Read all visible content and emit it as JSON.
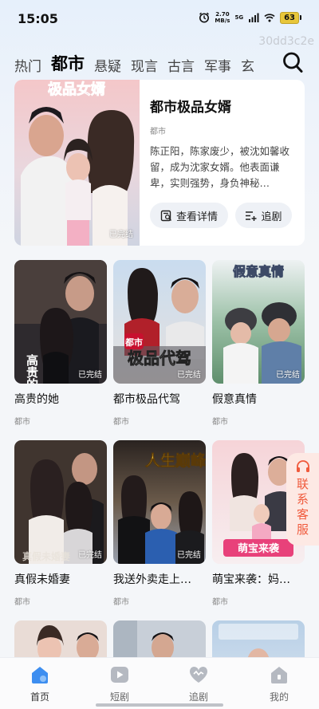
{
  "status_bar": {
    "time": "15:05",
    "net_speed": "2.70",
    "net_unit": "MB/s",
    "signal": "5G",
    "battery": "63"
  },
  "watermark": "30dd3c2e",
  "tabs": [
    {
      "label": "热门",
      "active": false
    },
    {
      "label": "都市",
      "active": true
    },
    {
      "label": "悬疑",
      "active": false
    },
    {
      "label": "现言",
      "active": false
    },
    {
      "label": "古言",
      "active": false
    },
    {
      "label": "军事",
      "active": false
    },
    {
      "label": "玄",
      "active": false
    }
  ],
  "featured": {
    "poster_text": "极品女婿",
    "title": "都市极品女婿",
    "genre": "都市",
    "description": "陈正阳，陈家废少，被沈如馨收留，成为沈家女婿。他表面谦卑，实则强势，身负神秘…",
    "status": "已完结",
    "detail_label": "查看详情",
    "follow_label": "追剧"
  },
  "dramas": [
    {
      "title": "高贵的她",
      "genre": "都市",
      "status": "已完结",
      "poster_text": "高贵的她"
    },
    {
      "title": "都市极品代驾",
      "genre": "都市",
      "status": "已完结",
      "poster_text": "极品代驾",
      "poster_tag": "都市"
    },
    {
      "title": "假意真情",
      "genre": "都市",
      "status": "已完结",
      "poster_text": "假意真情"
    },
    {
      "title": "真假未婚妻",
      "genre": "都市",
      "status": "已完结",
      "poster_text": "真假未婚妻"
    },
    {
      "title": "我送外卖走上…",
      "genre": "都市",
      "status": "已完结",
      "poster_text": "人生巅峰"
    },
    {
      "title": "萌宝来袭：妈…",
      "genre": "都市",
      "status": "",
      "poster_text": "萌宝来袭"
    }
  ],
  "customer_service": {
    "label": "联系客服"
  },
  "bottom_nav": [
    {
      "label": "首页",
      "icon": "home-icon",
      "active": true
    },
    {
      "label": "短剧",
      "icon": "play-icon",
      "active": false
    },
    {
      "label": "追剧",
      "icon": "heart-icon",
      "active": false
    },
    {
      "label": "我的",
      "icon": "profile-icon",
      "active": false
    }
  ],
  "colors": {
    "accent_blue": "#3d8ef0",
    "service_orange": "#f05a3c",
    "battery_yellow": "#e8c63a"
  }
}
